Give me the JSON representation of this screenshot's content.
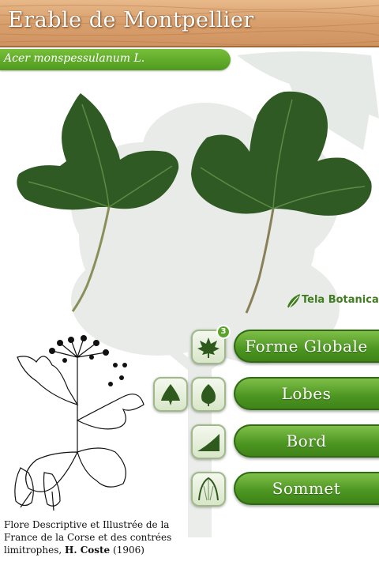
{
  "header": {
    "title": "Erable de Montpellier",
    "latin_name": "Acer monspessulanum L."
  },
  "logo": {
    "text": "Tela Botanica"
  },
  "criteria": [
    {
      "label": "Forme Globale",
      "badge": "3",
      "icon": "leaf-shape-icon"
    },
    {
      "label": "Lobes",
      "icon": "lobe-shape-icon"
    },
    {
      "label": "Bord",
      "icon": "leaf-edge-icon"
    },
    {
      "label": "Sommet",
      "icon": "leaf-tip-icon"
    }
  ],
  "caption": {
    "text_line1": "Flore Descriptive et Illustrée de la",
    "text_line2": "France de la Corse et des contrées",
    "text_line3_prefix": "limitrophes,",
    "author": "H. Coste",
    "year": "(1906)"
  },
  "colors": {
    "header_wood": "#d9a16e",
    "accent_green": "#4f9a1f",
    "leaf_dark": "#2f5a23"
  }
}
